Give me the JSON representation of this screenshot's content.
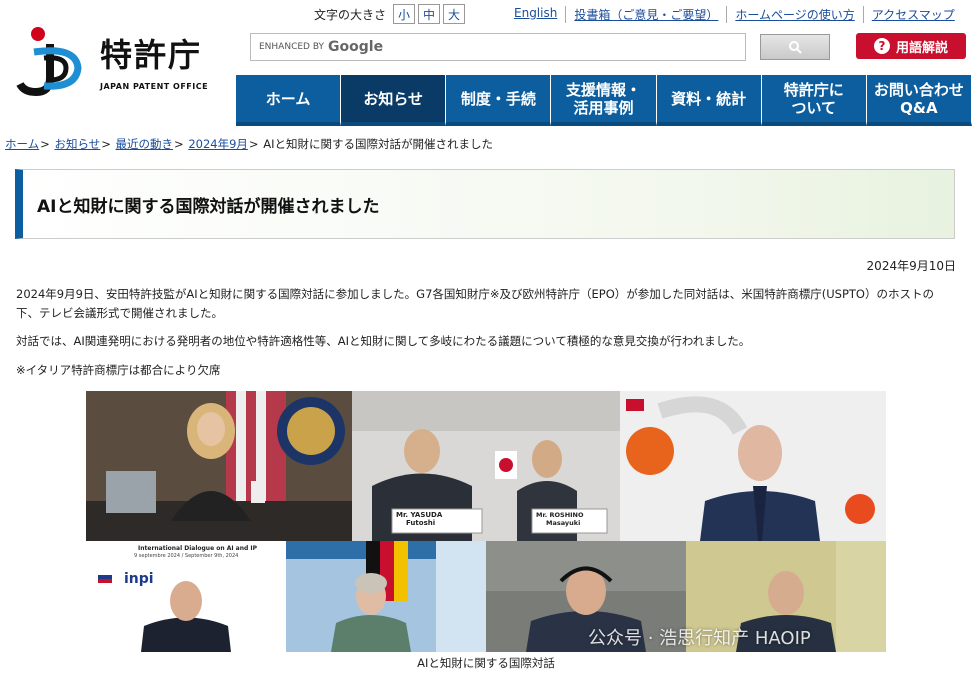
{
  "header": {
    "logo_name": "特許庁",
    "logo_sub": "JAPAN PATENT OFFICE",
    "fontsize_label": "文字の大きさ",
    "fontsizes": [
      "小",
      "中",
      "大"
    ],
    "links": [
      "English",
      "投書箱（ご意見・ご要望）",
      "ホームページの使い方",
      "アクセスマップ"
    ],
    "search_enhanced": "ENHANCED BY",
    "search_google": "Google",
    "search_placeholder": "",
    "glossary_label": "用語解説"
  },
  "nav": {
    "items": [
      {
        "label": "ホーム"
      },
      {
        "label": "お知らせ"
      },
      {
        "label": "制度・手続"
      },
      {
        "label": "支援情報・活用事例"
      },
      {
        "label": "資料・統計"
      },
      {
        "label": "特許庁について"
      },
      {
        "label": "お問い合わせQ&A"
      }
    ]
  },
  "breadcrumb": {
    "items": [
      "ホーム",
      "お知らせ",
      "最近の動き",
      "2024年9月"
    ],
    "sep": ">",
    "current": "AIと知財に関する国際対話が開催されました"
  },
  "article": {
    "title": "AIと知財に関する国際対話が開催されました",
    "date": "2024年9月10日",
    "para1": "2024年9月9日、安田特許技監がAIと知財に関する国際対話に参加しました。G7各国知財庁※及び欧州特許庁（EPO）が参加した同対話は、米国特許商標庁(USPTO）のホストの下、テレビ会議形式で開催されました。",
    "para2": "対話では、AI関連発明における発明者の地位や特許適格性等、AIと知財に関して多岐にわたる議題について積極的な意見交換が行われました。",
    "note": "※イタリア特許商標庁は都合により欠席",
    "photo_nameplate1": "Mr. YASUDA",
    "photo_nameplate1b": "Futoshi",
    "photo_nameplate2": "Mr. ROSHINO",
    "photo_nameplate2b": "Masayuki",
    "photo_slide_title": "International Dialogue on AI and IP",
    "photo_slide_date": "9 septembre 2024 / September 9th, 2024",
    "photo_inpi": "inpi",
    "caption": "AIと知財に関する国際対話",
    "watermark": "公众号 · 浩思行知产 HAOIP"
  },
  "colors": {
    "nav": "#0d5e9e",
    "nav_active": "#0a3a66",
    "glossary": "#c8102e",
    "link": "#1a4d9c"
  }
}
